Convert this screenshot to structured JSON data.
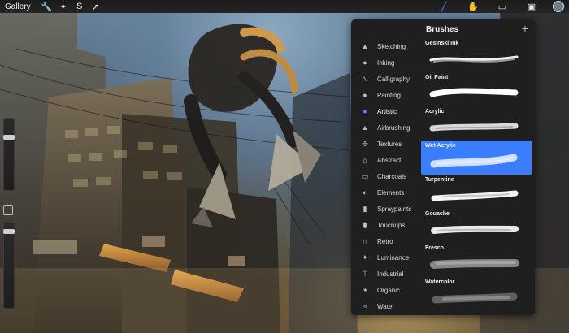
{
  "toolbar": {
    "gallery_label": "Gallery",
    "left_tools": [
      {
        "name": "wrench-icon",
        "glyph": "🔧"
      },
      {
        "name": "magic-wand-icon",
        "glyph": "✦"
      },
      {
        "name": "selection-icon",
        "glyph": "S"
      },
      {
        "name": "transform-icon",
        "glyph": "➚"
      }
    ],
    "right_tools": [
      {
        "name": "paintbrush-icon",
        "glyph": "╱",
        "active": true
      },
      {
        "name": "smudge-icon",
        "glyph": "✋"
      },
      {
        "name": "eraser-icon",
        "glyph": "▭"
      },
      {
        "name": "layers-icon",
        "glyph": "▣"
      }
    ],
    "accent_color": "#4d8dff"
  },
  "brushes_panel": {
    "title": "Brushes",
    "add_label": "+",
    "categories": [
      {
        "label": "Sketching",
        "icon": "pencil-icon",
        "glyph": "▲"
      },
      {
        "label": "Inking",
        "icon": "ink-drop-icon",
        "glyph": "●"
      },
      {
        "label": "Calligraphy",
        "icon": "calligraphy-icon",
        "glyph": "∿"
      },
      {
        "label": "Painting",
        "icon": "paint-drop-icon",
        "glyph": "●"
      },
      {
        "label": "Artistic",
        "icon": "artistic-drop-icon",
        "glyph": "●",
        "active": true
      },
      {
        "label": "Airbrushing",
        "icon": "airbrush-icon",
        "glyph": "▲"
      },
      {
        "label": "Textures",
        "icon": "texture-icon",
        "glyph": "✣"
      },
      {
        "label": "Abstract",
        "icon": "abstract-icon",
        "glyph": "△"
      },
      {
        "label": "Charcoals",
        "icon": "charcoal-icon",
        "glyph": "▭"
      },
      {
        "label": "Elements",
        "icon": "elements-icon",
        "glyph": "◐"
      },
      {
        "label": "Spraypaints",
        "icon": "spray-can-icon",
        "glyph": "▮"
      },
      {
        "label": "Touchups",
        "icon": "touchup-icon",
        "glyph": "⬮"
      },
      {
        "label": "Retro",
        "icon": "retro-icon",
        "glyph": "∩"
      },
      {
        "label": "Luminance",
        "icon": "luminance-icon",
        "glyph": "✦"
      },
      {
        "label": "Industrial",
        "icon": "anvil-icon",
        "glyph": "⊤"
      },
      {
        "label": "Organic",
        "icon": "leaf-icon",
        "glyph": "❧"
      },
      {
        "label": "Water",
        "icon": "water-icon",
        "glyph": "≈"
      }
    ],
    "brushes": [
      {
        "name": "Gesinski Ink",
        "selected": false
      },
      {
        "name": "Oil Paint",
        "selected": false
      },
      {
        "name": "Acrylic",
        "selected": false
      },
      {
        "name": "Wet Acrylic",
        "selected": true
      },
      {
        "name": "Turpentine",
        "selected": false
      },
      {
        "name": "Gouache",
        "selected": false
      },
      {
        "name": "Fresco",
        "selected": false
      },
      {
        "name": "Watercolor",
        "selected": false
      }
    ],
    "selected_color": "#3a7dff"
  }
}
